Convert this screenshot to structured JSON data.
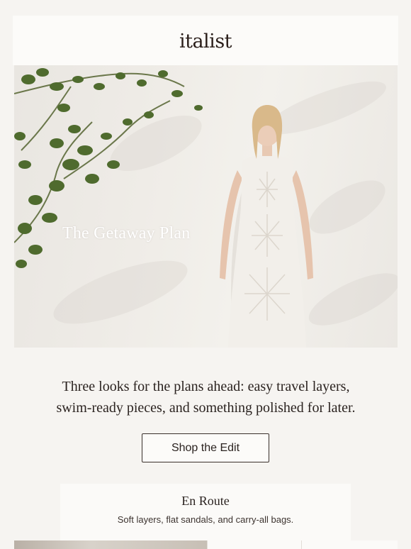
{
  "brand": {
    "logo_text": "italist"
  },
  "hero": {
    "title": "The Getaway Plan",
    "image_alt": "Model in a white crochet knit sleeveless dress against a sunlit white wall with climbing vines"
  },
  "intro": {
    "line1": "Three looks for the plans ahead: easy travel layers,",
    "line2": "swim-ready pieces, and something polished for later."
  },
  "cta": {
    "label": "Shop the Edit"
  },
  "section": {
    "title": "En Route",
    "subtitle": "Soft layers, flat sandals, and carry-all bags."
  },
  "colors": {
    "background": "#f6f4f1",
    "card": "#fcfbf9",
    "text": "#2b2320",
    "button_border": "#3a302c"
  }
}
